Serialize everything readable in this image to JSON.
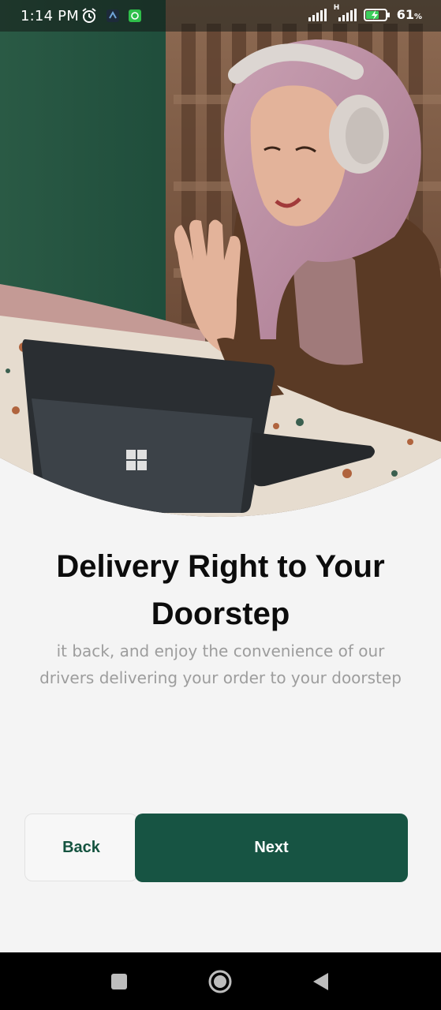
{
  "status_bar": {
    "time": "1:14 PM",
    "network_label": "H",
    "battery_percent": "61",
    "battery_unit": "%"
  },
  "onboarding": {
    "title_line1": "Delivery Right to Your",
    "title_line2": "Doorstep",
    "description_line1": "it back, and enjoy the convenience of our",
    "description_line2": "drivers delivering your order to your doorstep"
  },
  "actions": {
    "back_label": "Back",
    "next_label": "Next"
  },
  "colors": {
    "primary": "#175443",
    "background": "#f4f4f4",
    "title": "#0c0c0c",
    "description": "#9d9d9d"
  },
  "icons": {
    "alarm": "alarm-icon",
    "notification_app": "app-notification-icon",
    "wechat_like": "chat-app-icon",
    "signal": "signal-icon",
    "battery": "battery-charging-icon",
    "nav_recents": "square-recents-icon",
    "nav_home": "circle-home-icon",
    "nav_back": "triangle-back-icon"
  }
}
